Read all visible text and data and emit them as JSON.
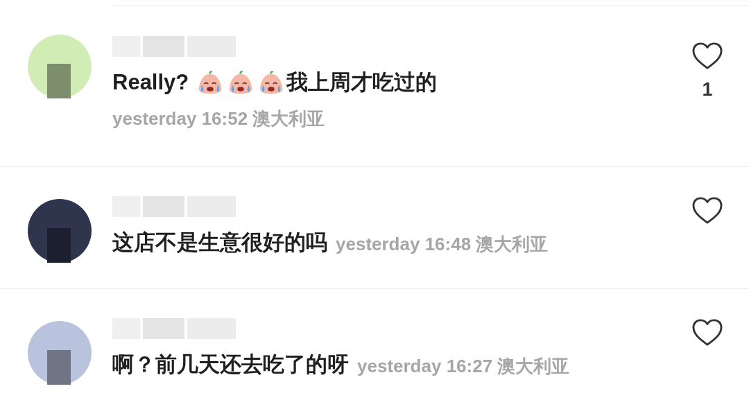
{
  "comments": [
    {
      "kind": "stacked",
      "color": "#cfeeb0",
      "parts": [
        {
          "kind": "text",
          "text": "Really? "
        },
        {
          "kind": "emoji"
        },
        {
          "kind": "emoji"
        },
        {
          "kind": "emoji"
        },
        {
          "kind": "text",
          "text": "我上周才吃过的"
        }
      ],
      "time": "yesterday 16:52",
      "location": "澳大利亚",
      "liked": false,
      "likes": "1"
    },
    {
      "kind": "inline",
      "color": "#2e3550",
      "parts": [
        {
          "kind": "text",
          "text": "这店不是生意很好的吗"
        }
      ],
      "time": "yesterday 16:48",
      "location": "澳大利亚",
      "liked": false
    },
    {
      "kind": "inline",
      "color": "#b9c3e0",
      "parts": [
        {
          "kind": "text",
          "text": "啊？前几天还去吃了的呀"
        }
      ],
      "time": "yesterday 16:27",
      "location": "澳大利亚",
      "liked": false
    }
  ]
}
